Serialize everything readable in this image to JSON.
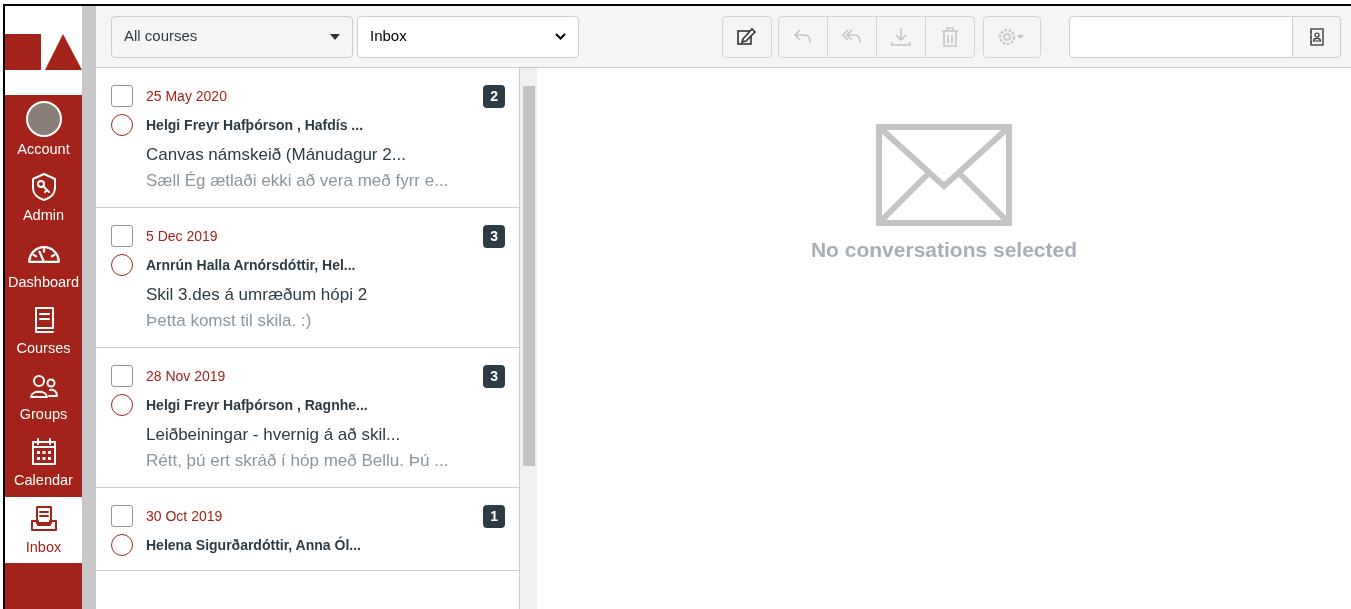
{
  "nav": {
    "items": [
      {
        "kind": "avatar",
        "label": "Account",
        "selected": false
      },
      {
        "kind": "admin",
        "label": "Admin",
        "selected": false
      },
      {
        "kind": "dashboard",
        "label": "Dashboard",
        "selected": false
      },
      {
        "kind": "courses",
        "label": "Courses",
        "selected": false
      },
      {
        "kind": "groups",
        "label": "Groups",
        "selected": false
      },
      {
        "kind": "calendar",
        "label": "Calendar",
        "selected": false
      },
      {
        "kind": "inbox",
        "label": "Inbox",
        "selected": true
      }
    ]
  },
  "toolbar": {
    "course_filter": "All courses",
    "mailbox": "Inbox",
    "actions": [
      {
        "kind": "compose",
        "disabled": false
      },
      {
        "kind": "reply",
        "disabled": true
      },
      {
        "kind": "reply_all",
        "disabled": true
      },
      {
        "kind": "archive",
        "disabled": true
      },
      {
        "kind": "delete",
        "disabled": true
      },
      {
        "kind": "settings",
        "disabled": true
      }
    ]
  },
  "conversations": [
    {
      "date": "25 May 2020",
      "count": "2",
      "participants": "Helgi Freyr Hafþórson , Hafdís ...",
      "subject": "Canvas námskeið (Mánudagur 2...",
      "preview": "Sæll Ég ætlaði ekki að vera með fyrr e...",
      "checked": false,
      "read": true
    },
    {
      "date": "5 Dec 2019",
      "count": "3",
      "participants": "Arnrún Halla Arnórsdóttir, Hel...",
      "subject": "Skil 3.des á umræðum hópi 2",
      "preview": "Þetta komst til skila. :)",
      "checked": false,
      "read": true
    },
    {
      "date": "28 Nov 2019",
      "count": "3",
      "participants": "Helgi Freyr Hafþórson , Ragnhe...",
      "subject": "Leiðbeiningar - hvernig á að skil...",
      "preview": "Rétt, þú ert skráð í hóp með Bellu. Þú ...",
      "checked": false,
      "read": true
    },
    {
      "date": "30 Oct 2019",
      "count": "1",
      "participants": "Helena Sigurðardóttir, Anna Ól...",
      "checked": false,
      "read": true
    }
  ],
  "empty_state": {
    "message": "No conversations selected"
  }
}
